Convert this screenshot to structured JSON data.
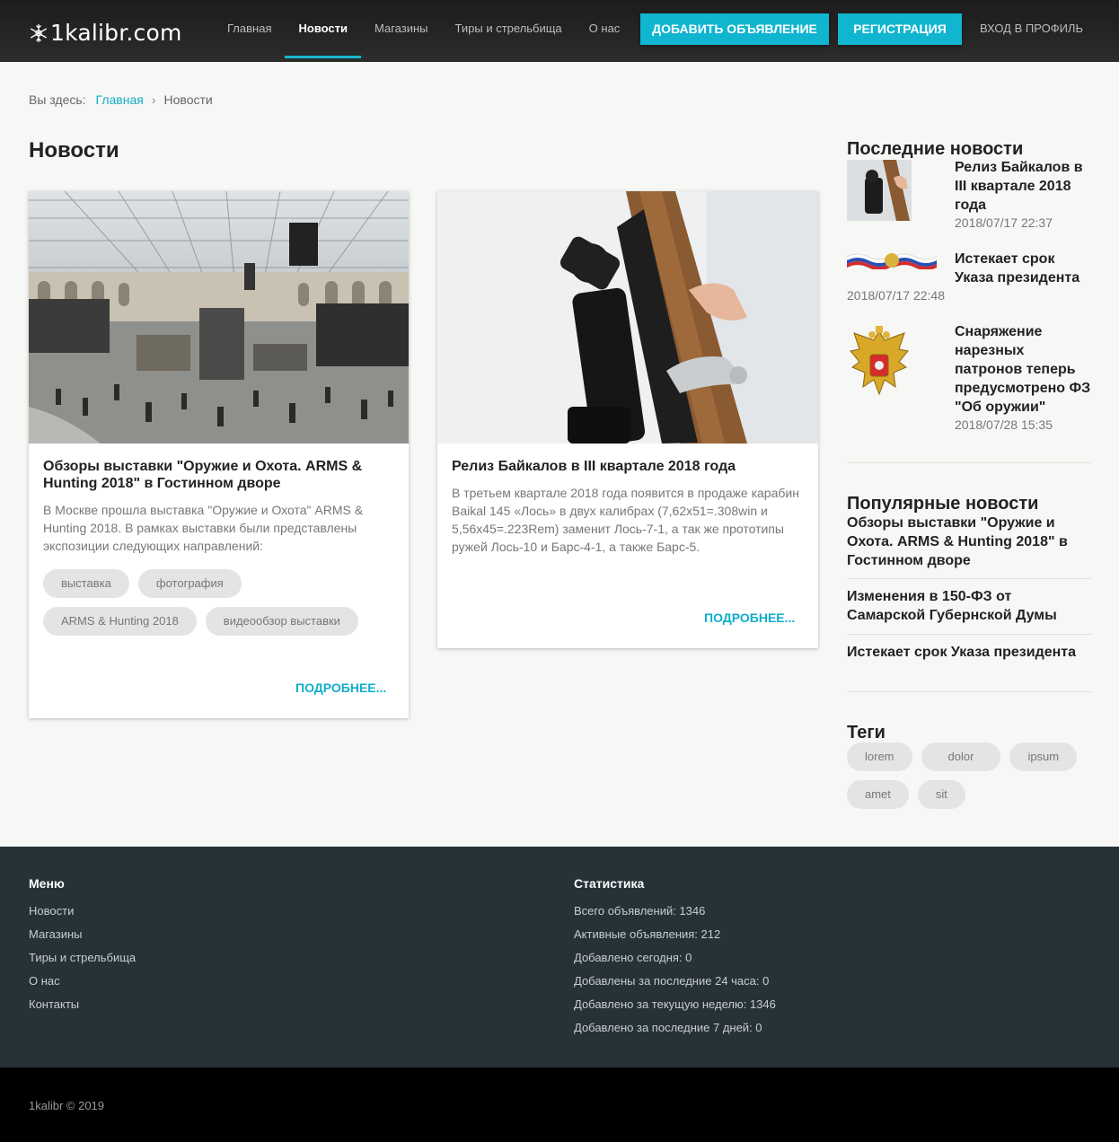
{
  "header": {
    "logo_text": "1kalibr.com",
    "nav": [
      "Главная",
      "Новости",
      "Магазины",
      "Тиры и стрельбища",
      "О нас"
    ],
    "active_nav": "Новости",
    "add_ad_button": "ДОБАВИТЬ ОБЪЯВЛЕНИЕ",
    "register_button": "РЕГИСТРАЦИЯ",
    "login_link": "ВХОД В ПРОФИЛЬ"
  },
  "breadcrumb": {
    "prefix": "Вы здесь:",
    "home": "Главная",
    "separator": "›",
    "current": "Новости"
  },
  "page_title": "Новости",
  "cards": [
    {
      "title": "Обзоры выставки \"Оружие и Охота. ARMS & Hunting 2018\" в Гостинном дворе",
      "text": "В Москве прошла выставка \"Оружие и Охота\" ARMS & Hunting 2018. В рамках выставки были представлены экспозиции следующих направлений:",
      "tags": [
        "выставка",
        "фотография",
        "ARMS & Hunting 2018",
        "видеообзор выставки"
      ],
      "more": "ПОДРОБНЕЕ..."
    },
    {
      "title": "Релиз Байкалов в III квартале 2018 года",
      "text": "В третьем квартале 2018 года  появится в продаже карабин Baikal 145 «Лось» в двух калибрах (7,62x51=.308win и 5,56x45=.223Rem) заменит Лось-7-1, а так же прототипы ружей Лось-10 и Барс-4-1, а также Барс-5.",
      "tags": [],
      "more": "ПОДРОБНЕЕ..."
    }
  ],
  "sidebar": {
    "latest_heading": "Последние новости",
    "latest": [
      {
        "title": "Релиз Байкалов в III квартале 2018 года",
        "date": "2018/07/17 22:37"
      },
      {
        "title": "Истекает срок Указа президента",
        "date": "2018/07/17 22:48"
      },
      {
        "title": "Снаряжение нарезных патронов теперь предусмотрено ФЗ \"Об оружии\"",
        "date": "2018/07/28 15:35"
      }
    ],
    "popular_heading": "Популярные новости",
    "popular": [
      "Обзоры выставки \"Оружие и Охота. ARMS & Hunting 2018\" в Гостинном дворе",
      "Изменения в 150-ФЗ от Самарской Губернской Думы",
      "Истекает срок Указа президента"
    ],
    "tags_heading": "Теги",
    "tags": [
      "lorem",
      "dolor",
      "ipsum",
      "amet",
      "sit"
    ]
  },
  "footer": {
    "menu_heading": "Меню",
    "menu": [
      "Новости",
      "Магазины",
      "Тиры и стрельбища",
      "О нас",
      "Контакты"
    ],
    "stats_heading": "Статистика",
    "stats": [
      "Всего объявлений: 1346",
      "Активные объявления: 212",
      "Добавлено сегодня: 0",
      "Добавлены за последние 24 часа: 0",
      "Добавлено за текущую неделю: 1346",
      "Добавлено за последние 7 дней: 0"
    ],
    "copyright": "1kalibr © 2019"
  },
  "colors": {
    "accent": "#10b5d0",
    "header_bg": "#222222",
    "footer_bg": "#263238",
    "page_bg": "#f7f7f5"
  }
}
